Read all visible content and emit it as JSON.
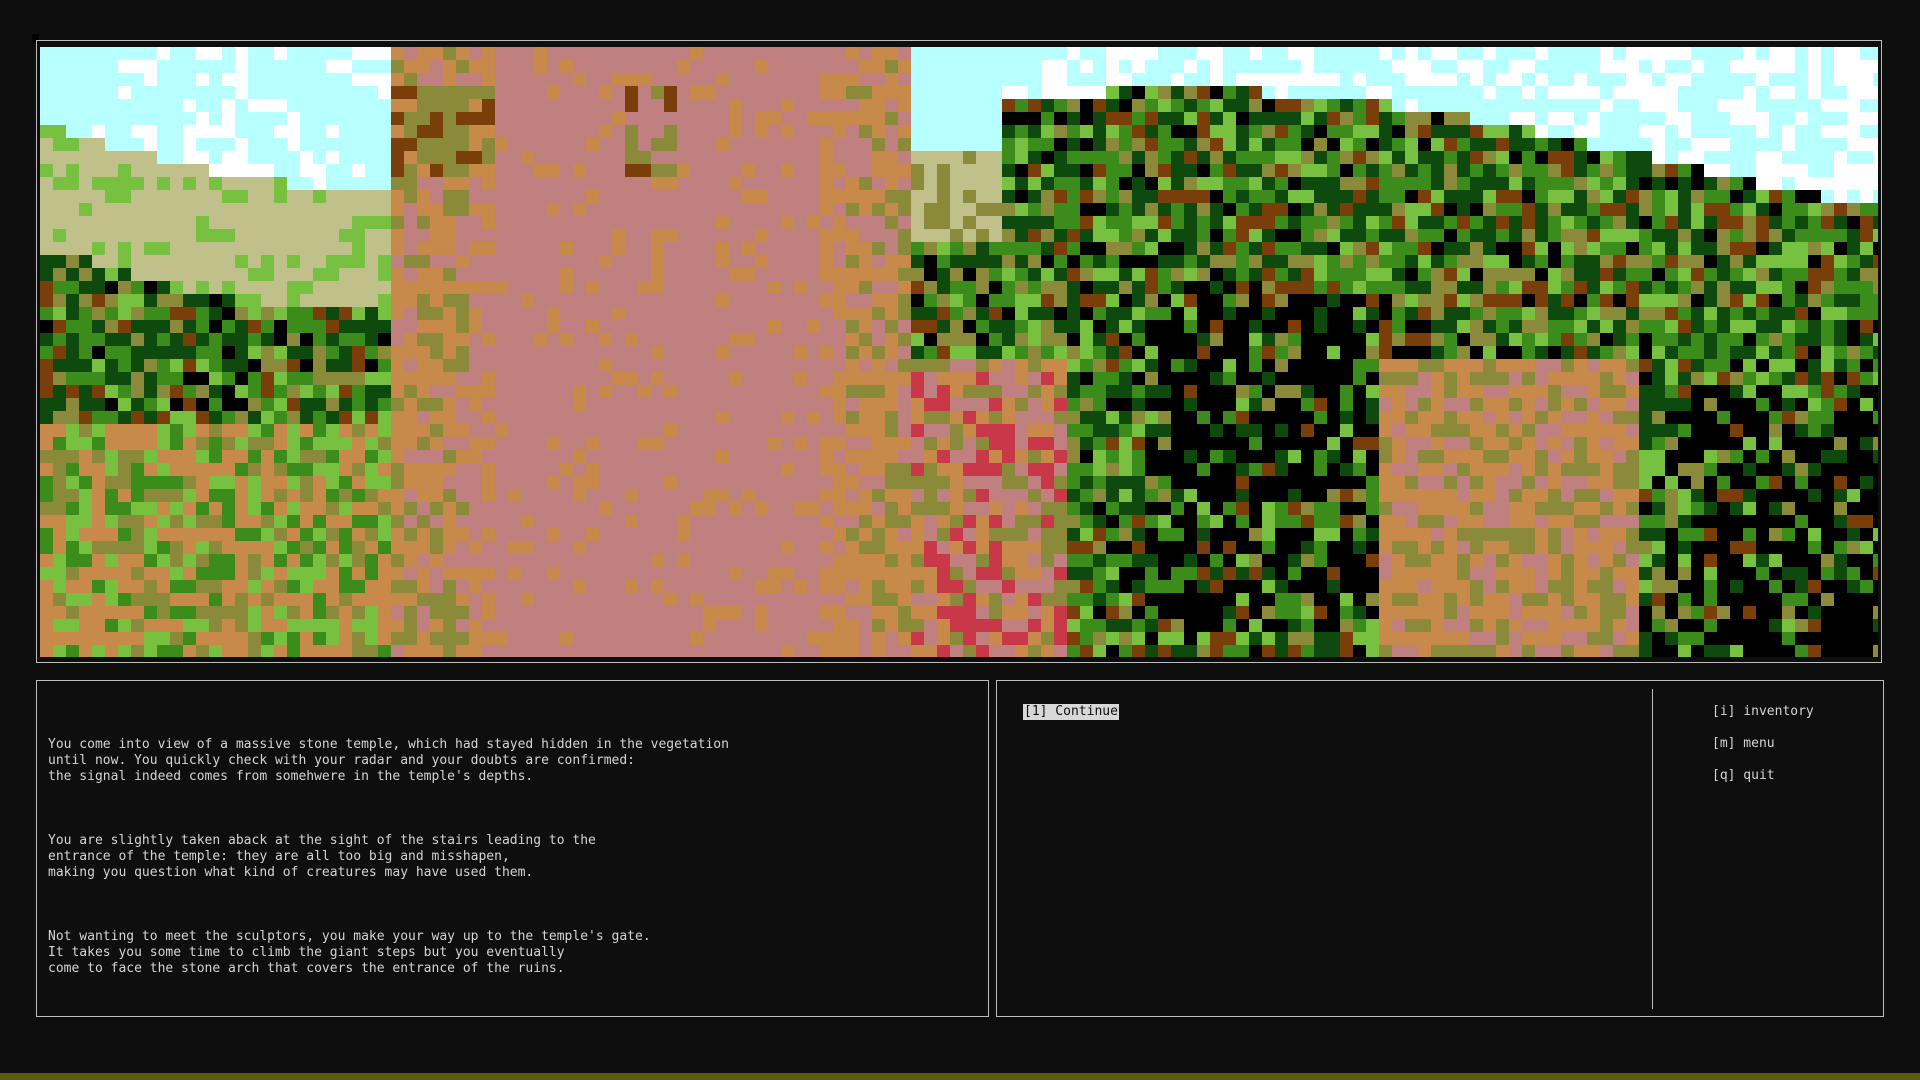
{
  "scene": {
    "description_icon": "jungle-temple-scene",
    "palette": {
      "sky": "#b8ffff",
      "cloud": "#ffffff",
      "stone_pink": "#c08080",
      "stone_orange": "#c88a4a",
      "olive": "#8a8a3a",
      "khaki": "#c0c08a",
      "green": "#3c8c1c",
      "light_green": "#78c040",
      "dark_green": "#0e4a0e",
      "black": "#000000",
      "brown": "#7a3e0a",
      "red": "#c83848"
    }
  },
  "story": {
    "paragraphs": [
      "You come into view of a massive stone temple, which had stayed hidden in the vegetation\nuntil now. You quickly check with your radar and your doubts are confirmed:\nthe signal indeed comes from somehwere in the temple's depths.",
      "You are slightly taken aback at the sight of the stairs leading to the\nentrance of the temple: they are all too big and misshapen,\nmaking you question what kind of creatures may have used them.",
      "Not wanting to meet the sculptors, you make your way up to the temple's gate.\nIt takes you some time to climb the giant steps but you eventually\ncome to face the stone arch that covers the entrance of the ruins."
    ]
  },
  "choices": [
    {
      "label": "[1]  Continue",
      "selected": true
    }
  ],
  "hotkeys": [
    {
      "label": "[i] inventory"
    },
    {
      "label": "[m] menu"
    },
    {
      "label": "[q] quit"
    }
  ],
  "colors": {
    "background": "#0e0e0e",
    "border": "#bdbdbd",
    "text": "#d4d4d4",
    "highlight": "#d8d8d8",
    "bottom_bar": "#5a5a12"
  }
}
